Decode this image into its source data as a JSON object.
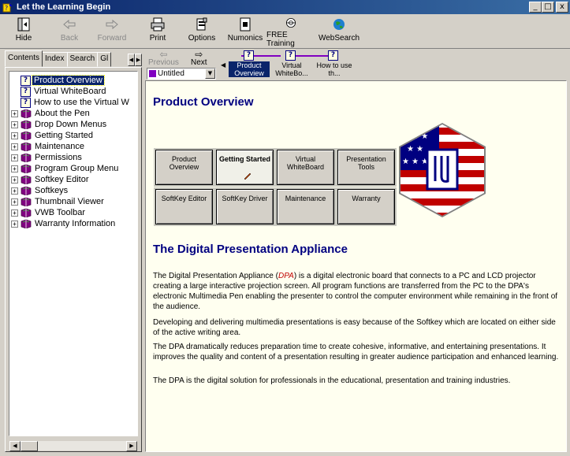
{
  "window": {
    "title": "Let the Learning Begin",
    "controls": [
      "_",
      "□",
      "x"
    ]
  },
  "toolbar": {
    "hide": "Hide",
    "back": "Back",
    "forward": "Forward",
    "print": "Print",
    "options": "Options",
    "numonics": "Numonics",
    "free_training": "FREE Training",
    "websearch": "WebSearch"
  },
  "leftpane": {
    "tabs": [
      "Contents",
      "Index",
      "Search",
      "Gl"
    ],
    "tree": [
      {
        "label": "Product Overview",
        "type": "topic",
        "selected": true
      },
      {
        "label": "Virtual WhiteBoard",
        "type": "topic"
      },
      {
        "label": "How to use the Virtual W",
        "type": "topic"
      },
      {
        "label": "About the Pen",
        "type": "book"
      },
      {
        "label": "Drop Down Menus",
        "type": "book"
      },
      {
        "label": "Getting Started",
        "type": "book"
      },
      {
        "label": "Maintenance",
        "type": "book"
      },
      {
        "label": "Permissions",
        "type": "book"
      },
      {
        "label": "Program Group Menu",
        "type": "book"
      },
      {
        "label": "Softkey Editor",
        "type": "book"
      },
      {
        "label": "Softkeys",
        "type": "book"
      },
      {
        "label": "Thumbnail Viewer",
        "type": "book"
      },
      {
        "label": "VWB Toolbar",
        "type": "book"
      },
      {
        "label": "Warranty Information",
        "type": "book"
      }
    ]
  },
  "navbar": {
    "previous": "Previous",
    "next": "Next",
    "topic_select": "Untitled",
    "crumbs": [
      {
        "label": "Product Overview",
        "current": true
      },
      {
        "label": "Virtual WhiteBo...",
        "current": false
      },
      {
        "label": "How to use th...",
        "current": false
      }
    ]
  },
  "content": {
    "heading": "Product Overview",
    "buttons": [
      "Product Overview",
      "Getting Started",
      "Virtual WhiteBoard",
      "Presentation Tools",
      "SoftKey Editor",
      "SoftKey Driver",
      "Maintenance",
      "Warranty"
    ],
    "subheading": "The Digital Presentation Appliance",
    "p1_a": "The Digital Presentation Appliance (",
    "p1_hl": "DPA",
    "p1_b": ") is a digital electronic board that connects to a PC and LCD projector creating a large interactive projection screen. All program functions are transferred from the PC to the DPA's electronic Multimedia Pen enabling the presenter to control the computer environment while remaining in the front of the audience.",
    "p2": "Developing and delivering multimedia presentations is easy because of the Softkey which are located on either side of the active writing area.",
    "p3": "The DPA dramatically reduces preparation time to create cohesive, informative, and entertaining presentations. It improves the quality and content of a presentation resulting in greater audience participation and enhanced learning.",
    "p4": "The DPA is the digital solution for professionals in the educational, presentation and training industries."
  },
  "colors": {
    "title_bar": "#0a246a",
    "heading": "#000080",
    "content_bg": "#fffff0",
    "crumb_line": "#8000c0"
  }
}
